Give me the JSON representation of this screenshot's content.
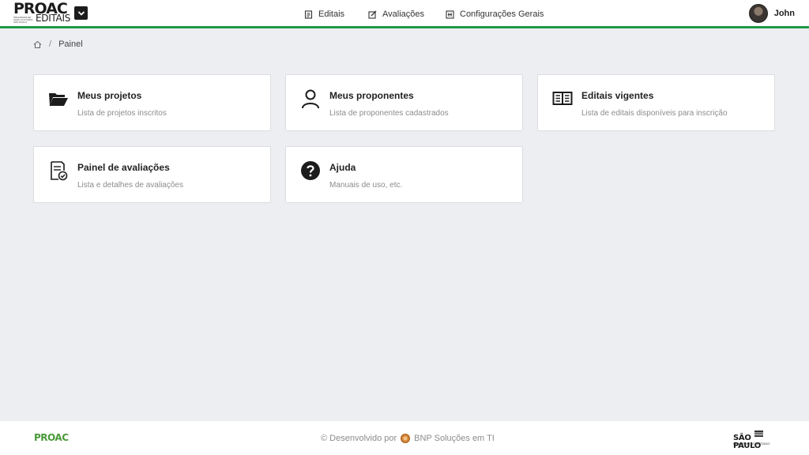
{
  "brand": {
    "logo_main": "PROAC",
    "logo_sub": "EDITAIS",
    "logo_tiny": "PROGRAMA DE AÇÃO CULTURAL SÃO PAULO"
  },
  "nav": {
    "items": [
      {
        "label": "Editais",
        "icon": "document-icon"
      },
      {
        "label": "Avaliações",
        "icon": "edit-icon"
      },
      {
        "label": "Configurações Gerais",
        "icon": "settings-grid-icon"
      }
    ]
  },
  "user": {
    "name": "John"
  },
  "breadcrumb": {
    "current": "Painel",
    "separator": "/"
  },
  "cards": [
    {
      "title": "Meus projetos",
      "desc": "Lista de projetos inscritos",
      "icon": "folder-open-icon"
    },
    {
      "title": "Meus proponentes",
      "desc": "Lista de proponentes cadastrados",
      "icon": "user-icon"
    },
    {
      "title": "Editais vigentes",
      "desc": "Lista de editais disponíveis para inscrição",
      "icon": "open-book-icon"
    },
    {
      "title": "Painel de avaliações",
      "desc": "Lista e detalhes de avaliações",
      "icon": "evaluation-document-icon"
    },
    {
      "title": "Ajuda",
      "desc": "Manuais de uso, etc.",
      "icon": "help-icon"
    }
  ],
  "footer": {
    "logo": "PROAC",
    "credit_prefix": "© Desenvolvido por",
    "credit_company": "BNP Soluções em TI",
    "sp_logo": "SÃO PAULO",
    "sp_sub": "GOVERNO DO ESTADO"
  },
  "colors": {
    "accent_green": "#1f9a45",
    "background": "#edeef1",
    "card_border": "#dcdde0"
  }
}
